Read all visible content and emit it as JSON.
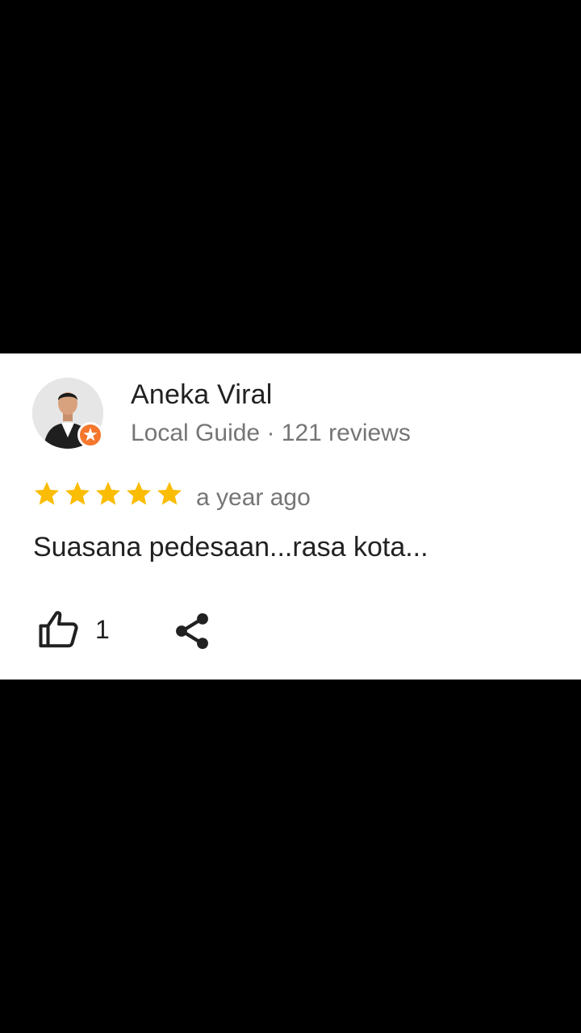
{
  "review": {
    "author": {
      "name": "Aneka Viral",
      "meta": "Local Guide · 121 reviews",
      "badge": "local-guide-badge"
    },
    "rating": 5,
    "date": "a year ago",
    "text": "Suasana pedesaan...rasa kota...",
    "likes": "1"
  },
  "icons": {
    "like": "thumbs-up-icon",
    "share": "share-icon",
    "star": "star-icon"
  },
  "colors": {
    "star": "#FBBC04",
    "badge": "#F4772D",
    "text_primary": "#212121",
    "text_secondary": "#757575"
  }
}
